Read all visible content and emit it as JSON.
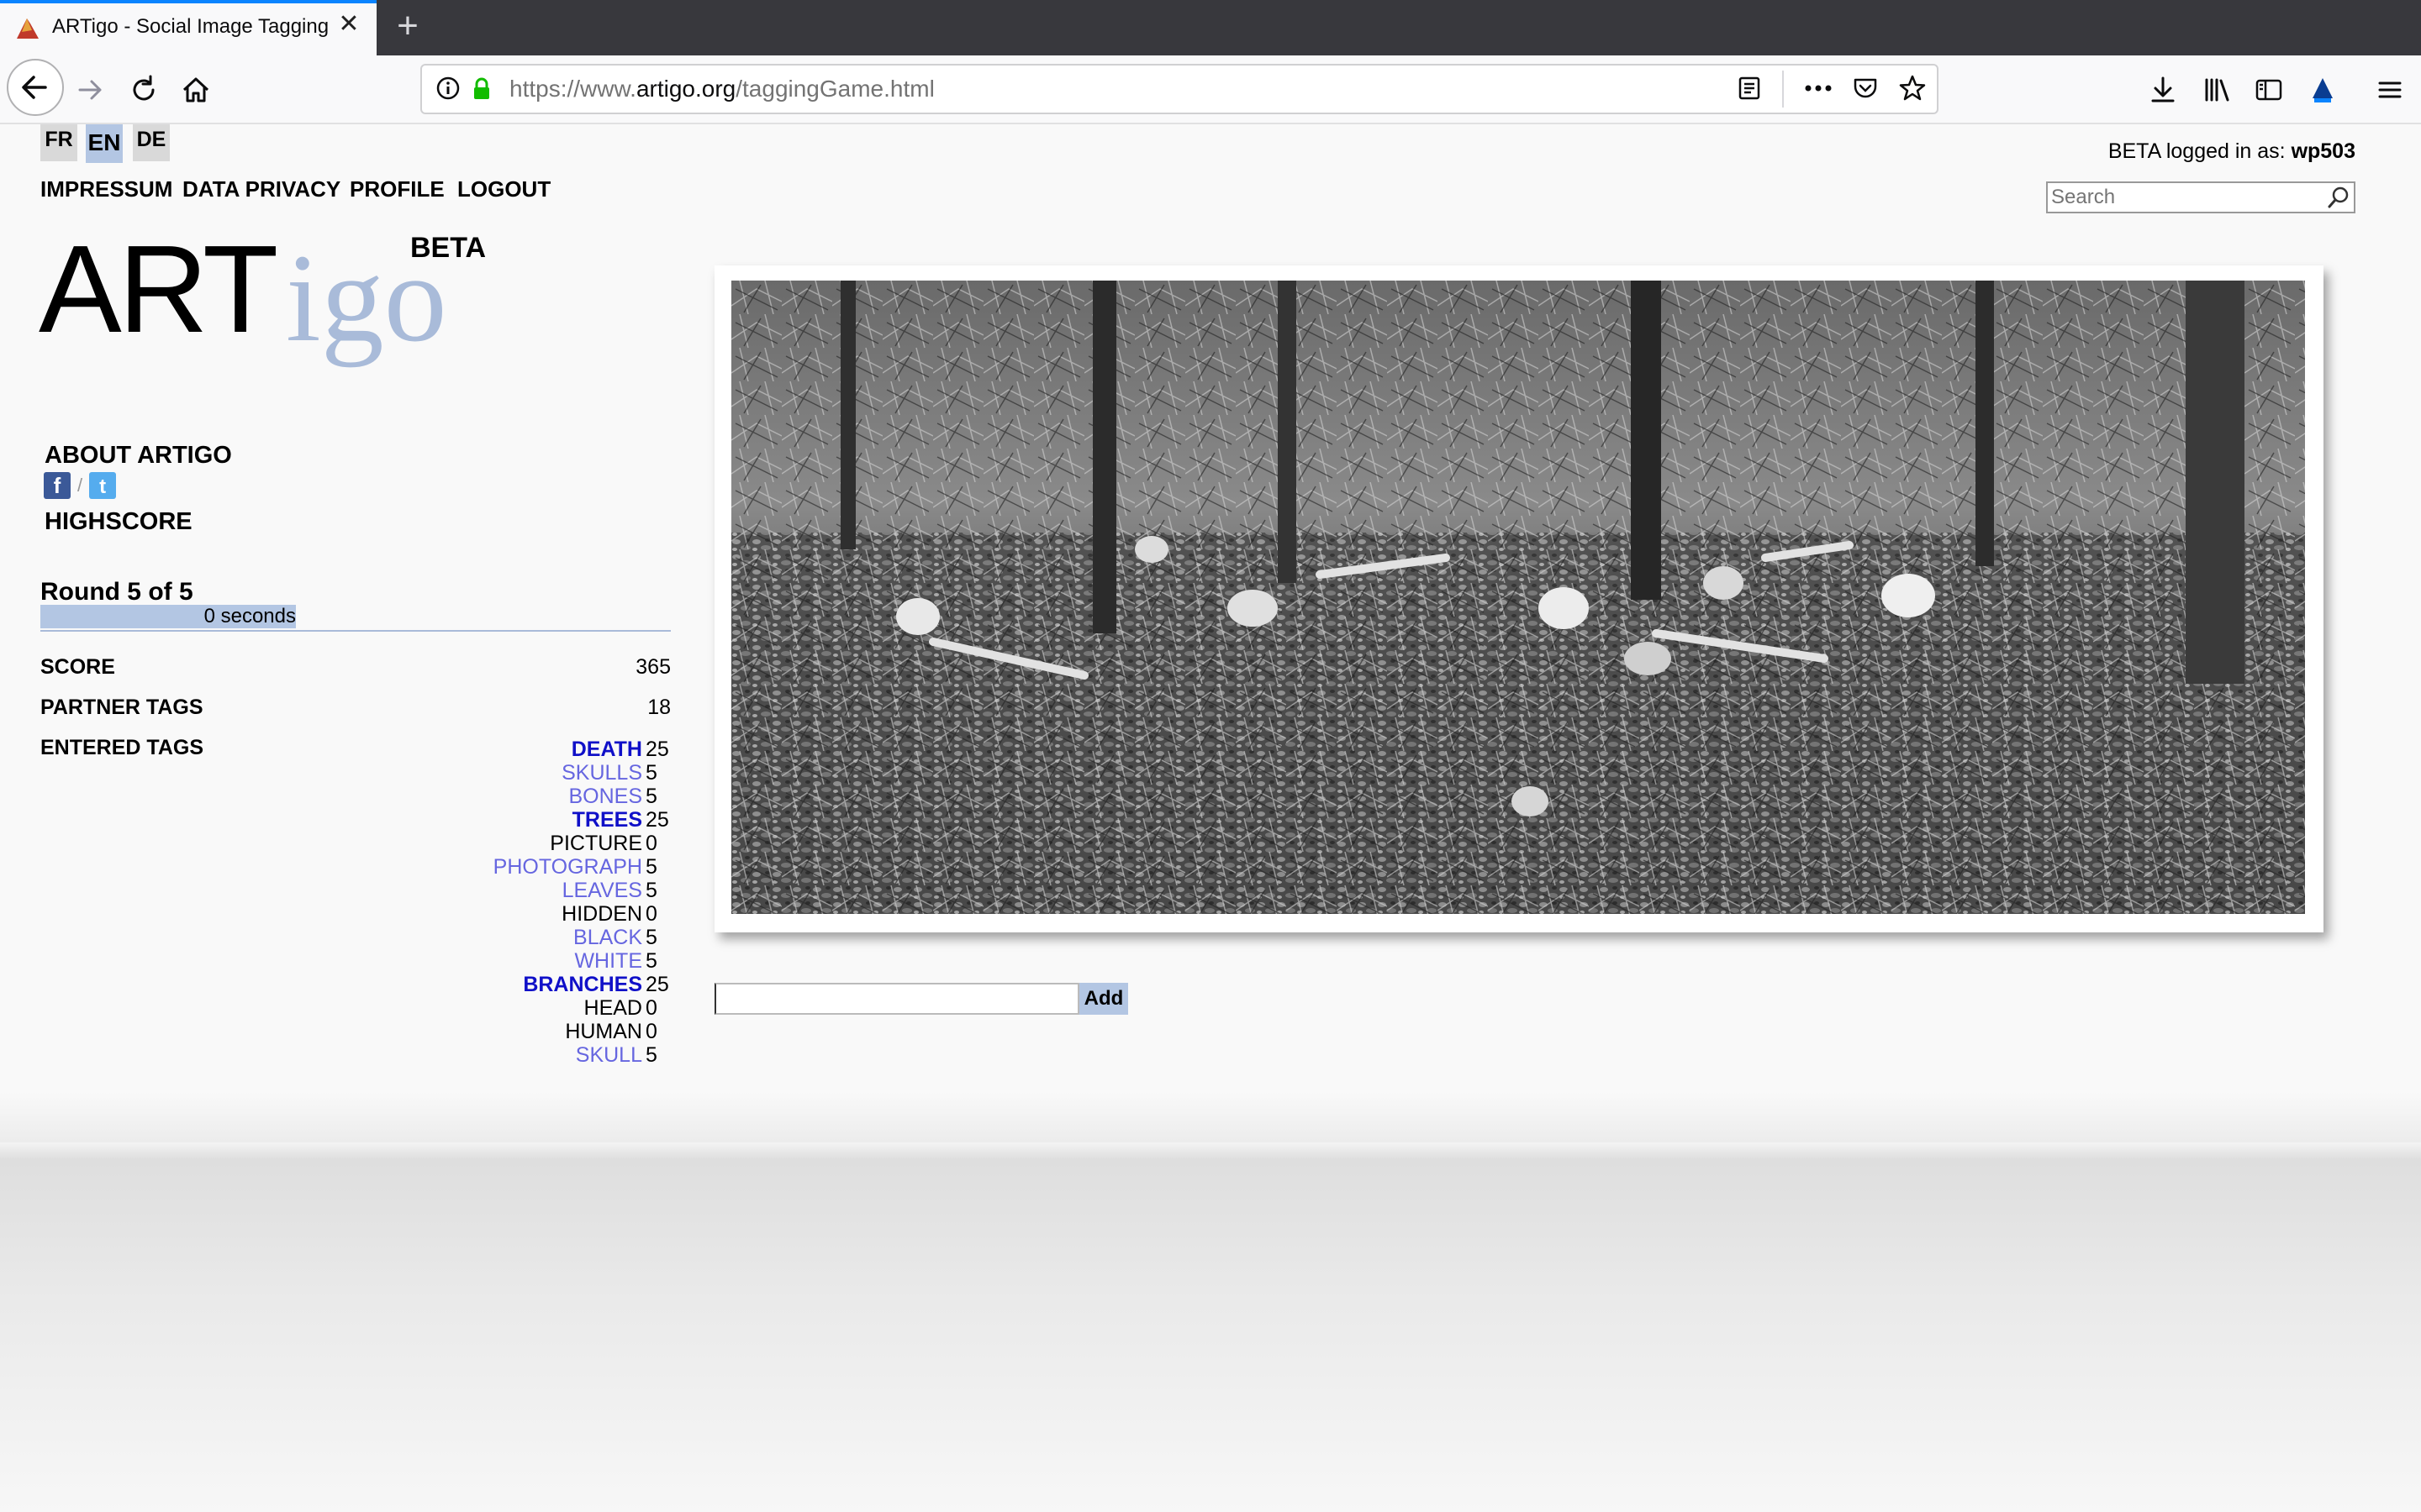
{
  "browser": {
    "tab_title": "ARTigo - Social Image Tagging",
    "new_tab_symbol": "+",
    "close_symbol": "✕",
    "url_prefix": "https://www.",
    "url_domain": "artigo.org",
    "url_path": "/taggingGame.html"
  },
  "languages": [
    "FR",
    "EN",
    "DE"
  ],
  "top_nav": {
    "impressum": "IMPRESSUM",
    "data_privacy": "DATA PRIVACY",
    "profile": "PROFILE",
    "logout": "LOGOUT"
  },
  "login": {
    "prefix": "BETA logged in as: ",
    "user": "wp503"
  },
  "search": {
    "placeholder": "Search"
  },
  "logo": {
    "art": "ART",
    "igo": "igo",
    "beta": "BETA"
  },
  "sidebar": {
    "about": "ABOUT ARTIGO",
    "social_separator": "/",
    "highscore": "HIGHSCORE"
  },
  "game": {
    "round_label": "Round 5 of 5",
    "timer_label": "0 seconds",
    "timer_fraction": 1.0,
    "score_label": "SCORE",
    "score_value": "365",
    "partner_tags_label": "PARTNER TAGS",
    "partner_tags_value": "18",
    "entered_tags_label": "ENTERED TAGS",
    "tags": [
      {
        "name": "DEATH",
        "score": "25"
      },
      {
        "name": "SKULLS",
        "score": "5"
      },
      {
        "name": "BONES",
        "score": "5"
      },
      {
        "name": "TREES",
        "score": "25"
      },
      {
        "name": "PICTURE",
        "score": "0"
      },
      {
        "name": "PHOTOGRAPH",
        "score": "5"
      },
      {
        "name": "LEAVES",
        "score": "5"
      },
      {
        "name": "HIDDEN",
        "score": "0"
      },
      {
        "name": "BLACK",
        "score": "5"
      },
      {
        "name": "WHITE",
        "score": "5"
      },
      {
        "name": "BRANCHES",
        "score": "25"
      },
      {
        "name": "HEAD",
        "score": "0"
      },
      {
        "name": "HUMAN",
        "score": "0"
      },
      {
        "name": "SKULL",
        "score": "5"
      }
    ],
    "tag_input_value": "",
    "add_label": "Add"
  },
  "colors": {
    "accent_blue": "#b3c6e3",
    "tag_25": "#1010c8",
    "tag_5": "#6666e0",
    "tag_0": "#000000"
  }
}
